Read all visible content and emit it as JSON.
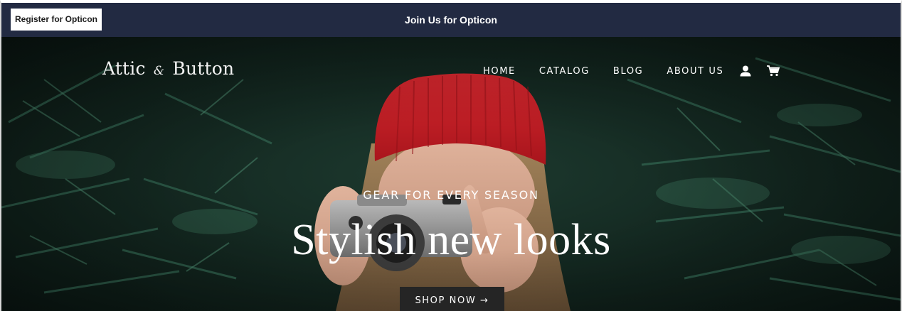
{
  "announcement": {
    "register_label": "Register for Opticon",
    "text": "Join Us for Opticon",
    "background": "#222a42"
  },
  "header": {
    "logo_part1": "Attic",
    "logo_amp": "&",
    "logo_part2": "Button",
    "nav": [
      {
        "label": "HOME"
      },
      {
        "label": "CATALOG"
      },
      {
        "label": "BLOG"
      },
      {
        "label": "ABOUT US"
      }
    ],
    "icons": [
      "account-icon",
      "cart-icon"
    ]
  },
  "hero": {
    "subheading": "GEAR FOR EVERY SEASON",
    "headline": "Stylish new looks",
    "button_label": "SHOP NOW →",
    "button_color": "#252525",
    "accent_hat": "#c8202a"
  }
}
